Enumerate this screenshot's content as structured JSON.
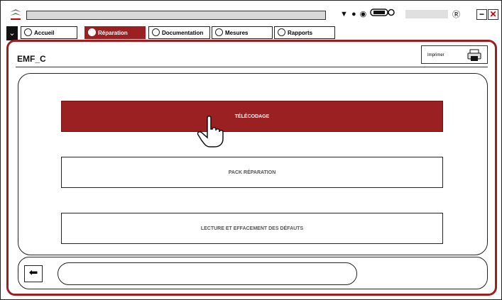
{
  "window": {
    "title": "",
    "top_icons": [
      "download-icon",
      "user-icon",
      "signal-icon",
      "battery-icon"
    ],
    "lock_icon": "lock-icon",
    "minimize_label": "−",
    "close_label": "✕"
  },
  "tabs": [
    {
      "label": "Accueil",
      "active": false
    },
    {
      "label": "Réparation",
      "active": true
    },
    {
      "label": "Documentation",
      "active": false
    },
    {
      "label": "Mesures",
      "active": false
    },
    {
      "label": "Rapports",
      "active": false
    }
  ],
  "page": {
    "title": "EMF_C",
    "print_label": "Imprimer"
  },
  "actions": [
    {
      "label": "TÉLÉCODAGE",
      "selected": true
    },
    {
      "label": "PACK RÉPARATION",
      "selected": false
    },
    {
      "label": "LECTURE ET EFFACEMENT DES DÉFAUTS",
      "selected": false
    }
  ],
  "footer": {
    "back_icon": "back-arrow-icon",
    "message": ""
  },
  "colors": {
    "accent": "#9a2022",
    "border": "#222222"
  }
}
